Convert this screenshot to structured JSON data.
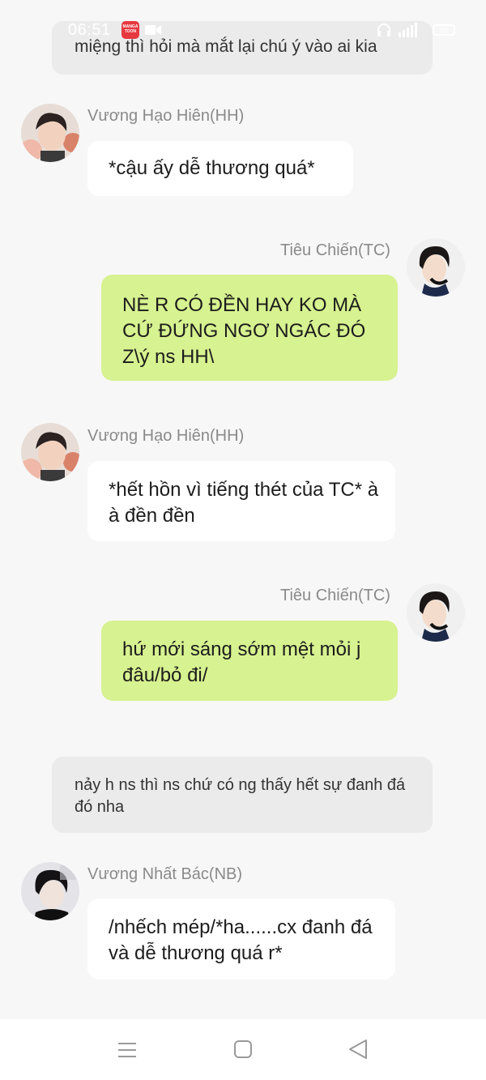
{
  "status_bar": {
    "time": "06:51",
    "app_icon_label": "MANGA TOON",
    "battery_label": "95"
  },
  "messages": [
    {
      "type": "narration",
      "text": "miệng thì hỏi mà mắt lại chú ý vào ai kia"
    },
    {
      "type": "left",
      "name": "Vương Hạo Hiên(HH)",
      "text": "*cậu ấy dễ thương quá*",
      "avatar": "avatar-hh"
    },
    {
      "type": "right",
      "name": "Tiêu Chiến(TC)",
      "text": "NÈ R CÓ ĐỀN HAY KO MÀ CỨ ĐỨNG NGƠ NGÁC ĐÓ Z\\ý ns HH\\",
      "avatar": "avatar-tc"
    },
    {
      "type": "left",
      "name": "Vương Hạo Hiên(HH)",
      "text": "*hết hồn vì tiếng thét của TC* à à đền đền",
      "avatar": "avatar-hh"
    },
    {
      "type": "right",
      "name": "Tiêu Chiến(TC)",
      "text": "hứ mới sáng sớm mệt mỏi j đâu/bỏ đi/",
      "avatar": "avatar-tc"
    },
    {
      "type": "narration",
      "text": "nảy h ns thì ns chứ có ng thấy hết sự đanh đá đó nha"
    },
    {
      "type": "left",
      "name": "Vương Nhất Bác(NB)",
      "text": "/nhếch mép/*ha......cx đanh đá và dễ thương quá r*",
      "avatar": "avatar-nb"
    }
  ],
  "colors": {
    "background": "#f7f7f7",
    "narration_bg": "#ebebeb",
    "bubble_left": "#ffffff",
    "bubble_right": "#d7f290",
    "name_text": "#8a8a8a"
  },
  "nav_icons": [
    "menu-icon",
    "home-icon",
    "back-icon"
  ]
}
